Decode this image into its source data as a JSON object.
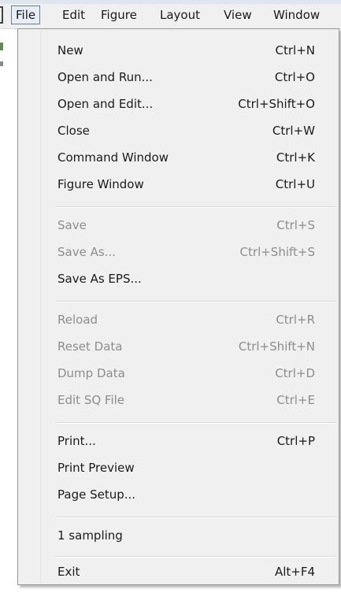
{
  "menubar": {
    "items": [
      {
        "label": "File"
      },
      {
        "label": "Edit"
      },
      {
        "label": "Figure"
      },
      {
        "label": "Layout"
      },
      {
        "label": "View"
      },
      {
        "label": "Window"
      }
    ]
  },
  "file_menu": {
    "groups": [
      {
        "items": [
          {
            "label": "New",
            "shortcut": "Ctrl+N",
            "enabled": true
          },
          {
            "label": "Open and Run...",
            "shortcut": "Ctrl+O",
            "enabled": true
          },
          {
            "label": "Open and Edit...",
            "shortcut": "Ctrl+Shift+O",
            "enabled": true
          },
          {
            "label": "Close",
            "shortcut": "Ctrl+W",
            "enabled": true
          },
          {
            "label": "Command Window",
            "shortcut": "Ctrl+K",
            "enabled": true
          },
          {
            "label": "Figure Window",
            "shortcut": "Ctrl+U",
            "enabled": true
          }
        ]
      },
      {
        "items": [
          {
            "label": "Save",
            "shortcut": "Ctrl+S",
            "enabled": false
          },
          {
            "label": "Save As...",
            "shortcut": "Ctrl+Shift+S",
            "enabled": false
          },
          {
            "label": "Save As EPS...",
            "shortcut": "",
            "enabled": true
          }
        ]
      },
      {
        "items": [
          {
            "label": "Reload",
            "shortcut": "Ctrl+R",
            "enabled": false
          },
          {
            "label": "Reset Data",
            "shortcut": "Ctrl+Shift+N",
            "enabled": false
          },
          {
            "label": "Dump Data",
            "shortcut": "Ctrl+D",
            "enabled": false
          },
          {
            "label": "Edit SQ File",
            "shortcut": "Ctrl+E",
            "enabled": false
          }
        ]
      },
      {
        "items": [
          {
            "label": "Print...",
            "shortcut": "Ctrl+P",
            "enabled": true
          },
          {
            "label": "Print Preview",
            "shortcut": "",
            "enabled": true
          },
          {
            "label": "Page Setup...",
            "shortcut": "",
            "enabled": true
          }
        ]
      },
      {
        "items": [
          {
            "label": "1 sampling",
            "shortcut": "",
            "enabled": true
          }
        ]
      },
      {
        "items": [
          {
            "label": "Exit",
            "shortcut": "Alt+F4",
            "enabled": true
          }
        ]
      }
    ]
  },
  "colors": {
    "menu_background": "#f0f0f0",
    "enabled_text": "#1a1a1a",
    "disabled_text": "#8d8d8d",
    "active_menu_highlight": "#e7eef6"
  }
}
